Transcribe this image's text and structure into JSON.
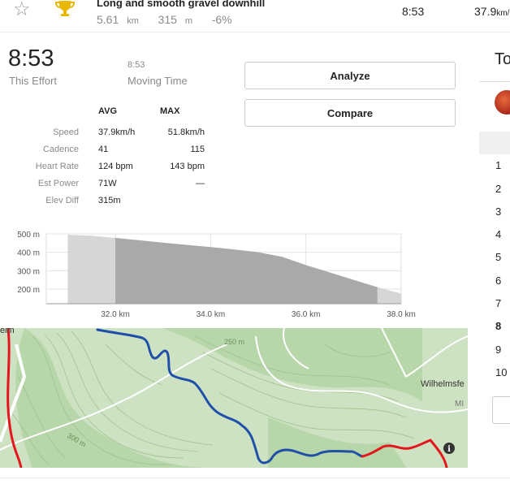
{
  "segment": {
    "name": "Long and smooth gravel downhill",
    "distance": "5.61",
    "distance_unit": "km",
    "elev": "315",
    "elev_unit": "m",
    "grade": "-6%",
    "time": "8:53",
    "speed": "37.9",
    "speed_unit": "km/"
  },
  "effort": {
    "time": "8:53",
    "time_label": "This Effort",
    "moving_time": "8:53",
    "moving_label": "Moving Time"
  },
  "buttons": {
    "analyze": "Analyze",
    "compare": "Compare"
  },
  "stats": {
    "avg_header": "AVG",
    "max_header": "MAX",
    "rows": [
      {
        "label": "Speed",
        "avg": "37.9km/h",
        "max": "51.8km/h"
      },
      {
        "label": "Cadence",
        "avg": "41",
        "max": "115"
      },
      {
        "label": "Heart Rate",
        "avg": "124 bpm",
        "max": "143 bpm"
      },
      {
        "label": "Est Power",
        "avg": "71W",
        "max": "—"
      },
      {
        "label": "Elev Diff",
        "avg": "315m",
        "max": ""
      }
    ]
  },
  "chart_data": {
    "type": "area",
    "x": [
      31.0,
      31.5,
      32.0,
      32.5,
      33.0,
      33.5,
      34.0,
      34.5,
      35.0,
      35.5,
      36.0,
      36.5,
      37.0,
      37.5,
      38.0
    ],
    "y": [
      495,
      490,
      478,
      465,
      452,
      440,
      428,
      415,
      400,
      375,
      330,
      290,
      250,
      210,
      175
    ],
    "highlight_range": [
      32.0,
      37.5
    ],
    "xticks": [
      "32.0 km",
      "34.0 km",
      "36.0 km",
      "38.0 km"
    ],
    "xtick_values": [
      32.0,
      34.0,
      36.0,
      38.0
    ],
    "yticks": [
      "500 m",
      "400 m",
      "300 m",
      "200 m"
    ],
    "ytick_values": [
      500,
      400,
      300,
      200
    ],
    "xlim": [
      30.55,
      38.0
    ],
    "ylim": [
      120,
      500
    ],
    "grid": true
  },
  "map": {
    "labels": {
      "contour_250": "250 m",
      "contour_300": "300 m",
      "town": "Wilhelmsfe",
      "edge_left": "elm",
      "edge_right": "MI"
    },
    "info_icon": "info-icon",
    "route_color": "#1f4fa8",
    "segment_color": "#e4151c"
  },
  "right_panel": {
    "title": "To",
    "ranks": [
      "1",
      "2",
      "3",
      "4",
      "5",
      "6",
      "7",
      "8",
      "9",
      "10"
    ]
  },
  "colors": {
    "accent": "#fc4c02",
    "text": "#242428",
    "muted": "#8a8a8e"
  }
}
